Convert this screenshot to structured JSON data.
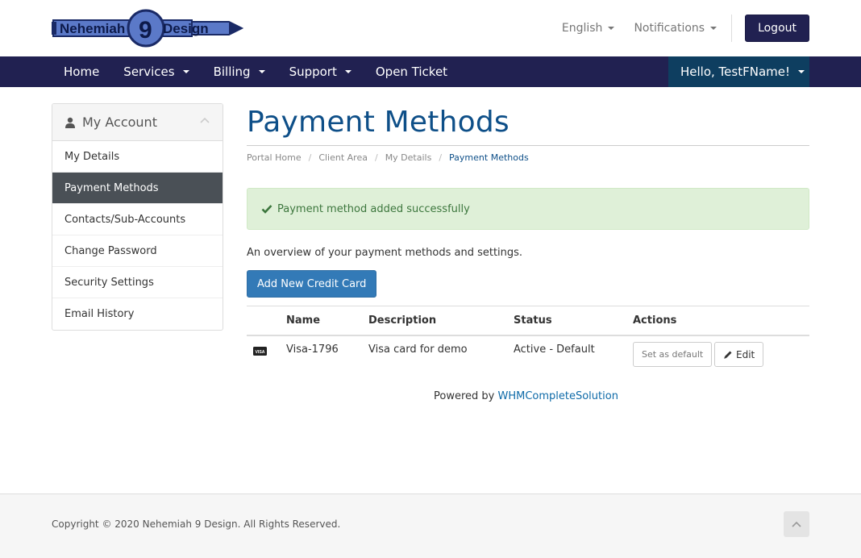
{
  "header": {
    "logo": {
      "text_left": "Nehemiah",
      "text_number": "9",
      "text_right": "Design"
    },
    "language": "English",
    "notifications": "Notifications",
    "logout": "Logout"
  },
  "navbar": {
    "items": [
      {
        "label": "Home",
        "dropdown": false
      },
      {
        "label": "Services",
        "dropdown": true
      },
      {
        "label": "Billing",
        "dropdown": true
      },
      {
        "label": "Support",
        "dropdown": true
      },
      {
        "label": "Open Ticket",
        "dropdown": false
      }
    ],
    "user": "Hello, TestFName!"
  },
  "sidebar": {
    "title": "My Account",
    "items": [
      {
        "label": "My Details",
        "active": false
      },
      {
        "label": "Payment Methods",
        "active": true
      },
      {
        "label": "Contacts/Sub-Accounts",
        "active": false
      },
      {
        "label": "Change Password",
        "active": false
      },
      {
        "label": "Security Settings",
        "active": false
      },
      {
        "label": "Email History",
        "active": false
      }
    ]
  },
  "main": {
    "title": "Payment Methods",
    "breadcrumb": [
      "Portal Home",
      "Client Area",
      "My Details",
      "Payment Methods"
    ],
    "alert": "Payment method added successfully",
    "overview": "An overview of your payment methods and settings.",
    "add_button": "Add New Credit Card",
    "table": {
      "headers": {
        "name": "Name",
        "description": "Description",
        "status": "Status",
        "actions": "Actions"
      },
      "rows": [
        {
          "card_icon": "VISA",
          "name": "Visa-1796",
          "description": "Visa card for demo",
          "status": "Active - Default",
          "set_default": "Set as default",
          "edit": "Edit"
        }
      ]
    },
    "powered_prefix": "Powered by ",
    "powered_link": "WHMCompleteSolution"
  },
  "footer": {
    "copyright": "Copyright © 2020 Nehemiah 9 Design. All Rights Reserved."
  },
  "colors": {
    "brand_navy": "#212151",
    "user_menu": "#0e3e60",
    "title_blue": "#0e4f88",
    "primary_button": "#337ab7",
    "alert_bg": "#dff0d8",
    "alert_text": "#3c763d",
    "sidebar_active": "#4a5056"
  }
}
